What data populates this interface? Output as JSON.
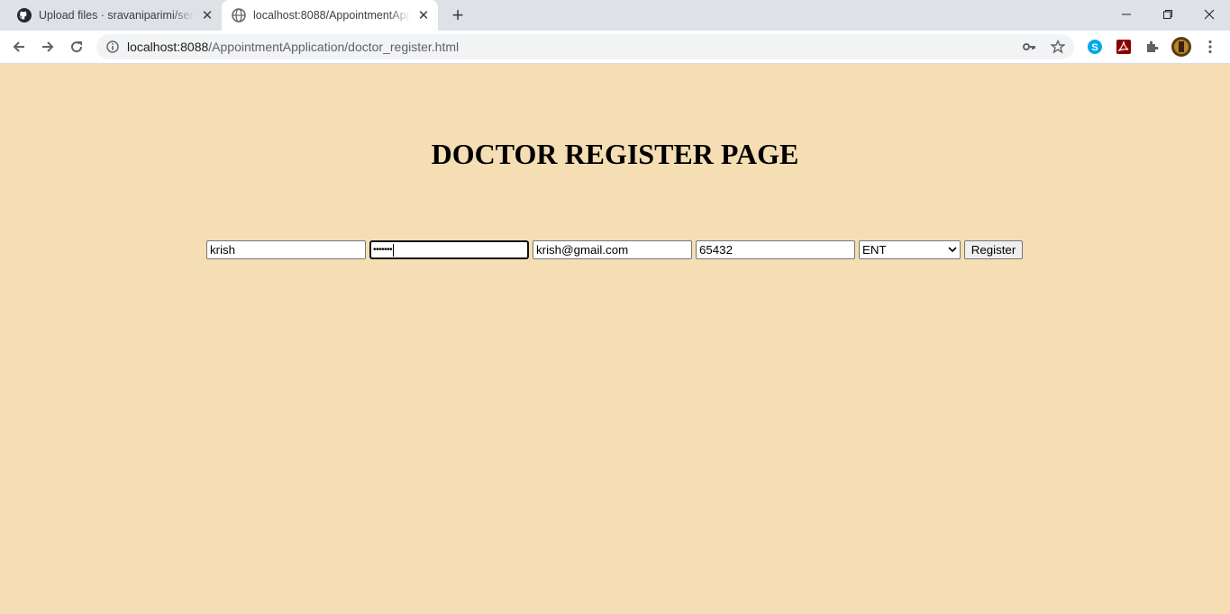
{
  "browser": {
    "tabs": [
      {
        "title": "Upload files · sravaniparimi/servic",
        "active": false,
        "icon": "github-icon"
      },
      {
        "title": "localhost:8088/AppointmentApp",
        "active": true,
        "icon": "globe-icon"
      }
    ],
    "new_tab_label": "+",
    "url_host": "localhost:8088",
    "url_path": "/AppointmentApplication/doctor_register.html"
  },
  "page": {
    "background": "#f5deb3",
    "heading": "DOCTOR REGISTER PAGE",
    "form": {
      "name_value": "krish",
      "password_value": "•••••••",
      "email_value": "krish@gmail.com",
      "phone_value": "65432",
      "specialization_selected": "ENT",
      "submit_label": "Register"
    }
  }
}
